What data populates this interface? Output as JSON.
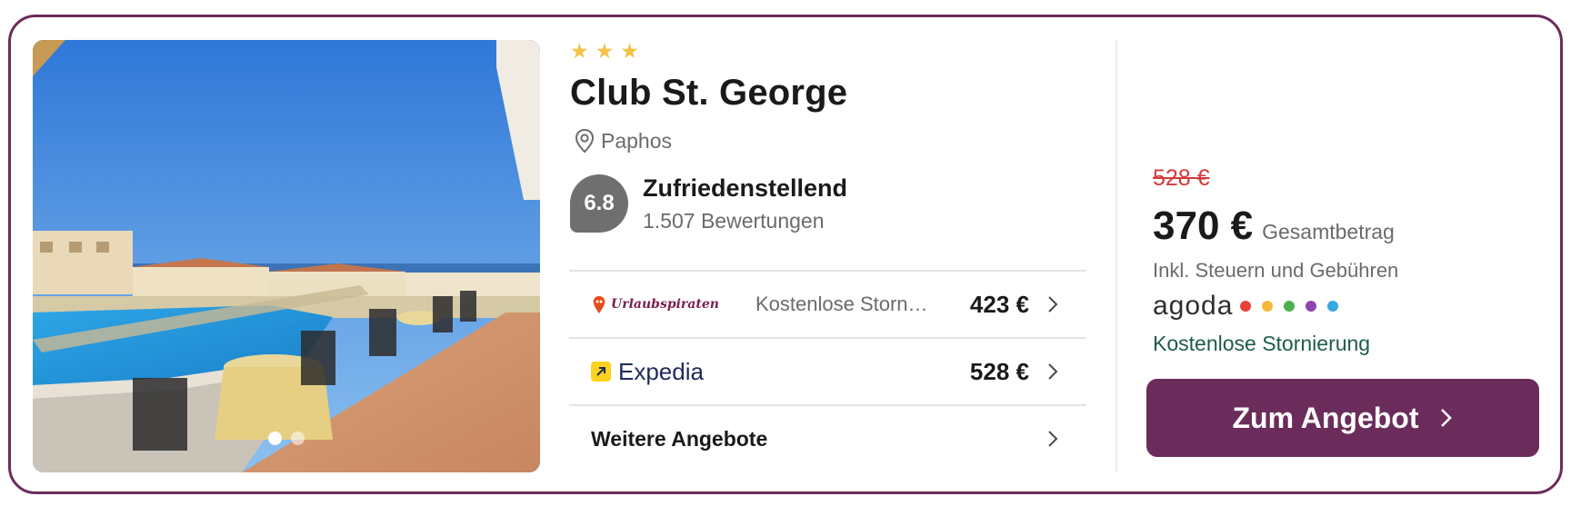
{
  "hotel": {
    "stars": [
      "★",
      "★",
      "★"
    ],
    "name": "Club St. George",
    "location": "Paphos",
    "score": "6.8",
    "rating_label": "Zufriedenstellend",
    "rating_count": "1.507 Bewertungen"
  },
  "gallery": {
    "image_count": 2,
    "active_index": 0
  },
  "offers": [
    {
      "provider": "Urlaubspiraten",
      "note": "Kostenlose Storn…",
      "price": "423 €"
    },
    {
      "provider": "Expedia",
      "note": "",
      "price": "528 €"
    }
  ],
  "more_offers_label": "Weitere Angebote",
  "deal": {
    "old_price": "528 €",
    "price": "370 €",
    "price_label": "Gesamtbetrag",
    "tax_note": "Inkl. Steuern und Gebühren",
    "provider": "agoda",
    "cancellation": "Kostenlose Stornierung",
    "cta_label": "Zum Angebot"
  },
  "colors": {
    "brand": "#6b2c5c",
    "star": "#f5c243",
    "old_price": "#d13b3b",
    "free_cancel": "#1e5c48",
    "agoda_dots": [
      "#e8413a",
      "#f5b83c",
      "#4cb050",
      "#8e44ad",
      "#3aa7e0"
    ]
  },
  "icons": {
    "location": "map-pin-icon",
    "chevron": "chevron-right-icon"
  }
}
